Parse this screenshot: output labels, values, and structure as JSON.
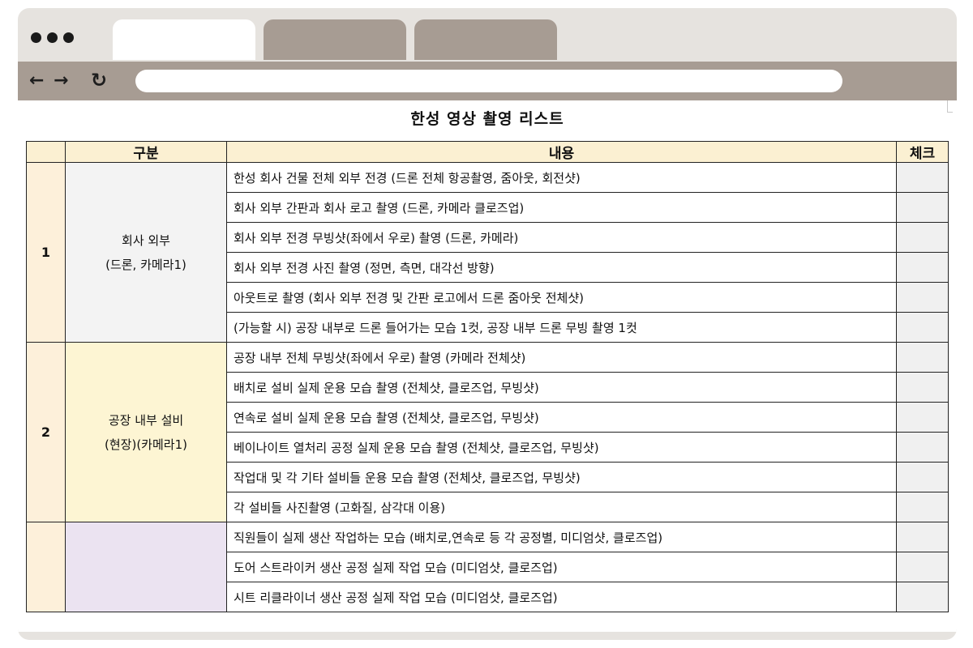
{
  "browser": {
    "back_icon": "arrow-left-icon",
    "forward_icon": "arrow-right-icon",
    "reload_icon": "reload-icon",
    "address": ""
  },
  "document": {
    "title": "한성 영상 촬영 리스트",
    "headers": {
      "number": "",
      "category": "구분",
      "content": "내용",
      "check": "체크"
    },
    "groups": [
      {
        "number": "1",
        "category_line1": "회사 외부",
        "category_line2": "(드론, 카메라1)",
        "items": [
          "한성 회사 건물 전체 외부 전경 (드론 전체 항공촬영, 줌아웃, 회전샷)",
          "회사 외부 간판과 회사 로고 촬영 (드론, 카메라 클로즈업)",
          "회사 외부 전경 무빙샷(좌에서 우로) 촬영 (드론, 카메라)",
          "회사 외부 전경 사진 촬영 (정면, 측면, 대각선 방향)",
          "아웃트로 촬영 (회사 외부 전경 및 간판 로고에서 드론 줌아웃 전체샷)",
          "(가능할 시) 공장 내부로 드론 들어가는 모습 1컷, 공장 내부 드론 무빙 촬영 1컷"
        ]
      },
      {
        "number": "2",
        "category_line1": "공장 내부 설비",
        "category_line2": "(현장)(카메라1)",
        "items": [
          "공장 내부 전체 무빙샷(좌에서 우로) 촬영 (카메라 전체샷)",
          "배치로 설비 실제 운용 모습 촬영 (전체샷, 클로즈업, 무빙샷)",
          "연속로 설비 실제 운용 모습 촬영 (전체샷, 클로즈업, 무빙샷)",
          "베이나이트 열처리 공정 실제 운용 모습 촬영 (전체샷, 클로즈업, 무빙샷)",
          "작업대 및 각 기타 설비들 운용 모습 촬영 (전체샷, 클로즈업, 무빙샷)",
          "각 설비들 사진촬영 (고화질, 삼각대 이용)"
        ]
      },
      {
        "number": "",
        "category_line1": "",
        "category_line2": "",
        "items": [
          "직원들이 실제 생산 작업하는 모습 (배치로,연속로 등 각 공정별, 미디엄샷, 클로즈업)",
          "도어 스트라이커 생산 공정 실제 작업 모습 (미디엄샷, 클로즈업)",
          "시트 리클라이너 생산 공정 실제 작업 모습 (미디엄샷, 클로즈업)"
        ]
      }
    ]
  }
}
